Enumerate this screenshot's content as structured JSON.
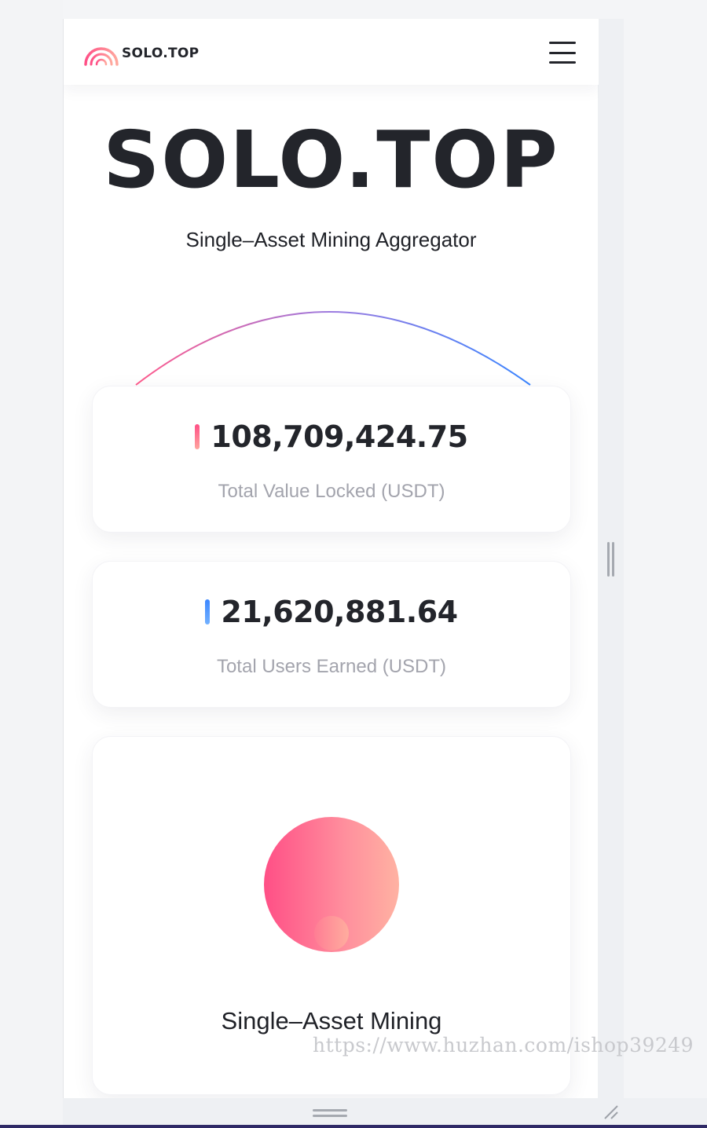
{
  "brand": {
    "name": "SOLO.TOP",
    "logo_icon": "rainbow-arc-icon"
  },
  "navbar": {
    "menu_icon": "hamburger-menu-icon"
  },
  "hero": {
    "title": "SOLO.TOP",
    "subtitle": "Single–Asset Mining Aggregator"
  },
  "stats": [
    {
      "value": "108,709,424.75",
      "label": "Total Value Locked (USDT)",
      "accent": "#ff4f86"
    },
    {
      "value": "21,620,881.64",
      "label": "Total Users Earned (USDT)",
      "accent": "#3b86ff"
    }
  ],
  "feature": {
    "title": "Single–Asset Mining",
    "icon": "gradient-orb-icon"
  },
  "watermark": "https://www.huzhan.com/ishop39249",
  "colors": {
    "text_dark": "#23252b",
    "label_gray": "#a3a4ad",
    "pink": "#ff4f86",
    "blue": "#3b86ff"
  }
}
